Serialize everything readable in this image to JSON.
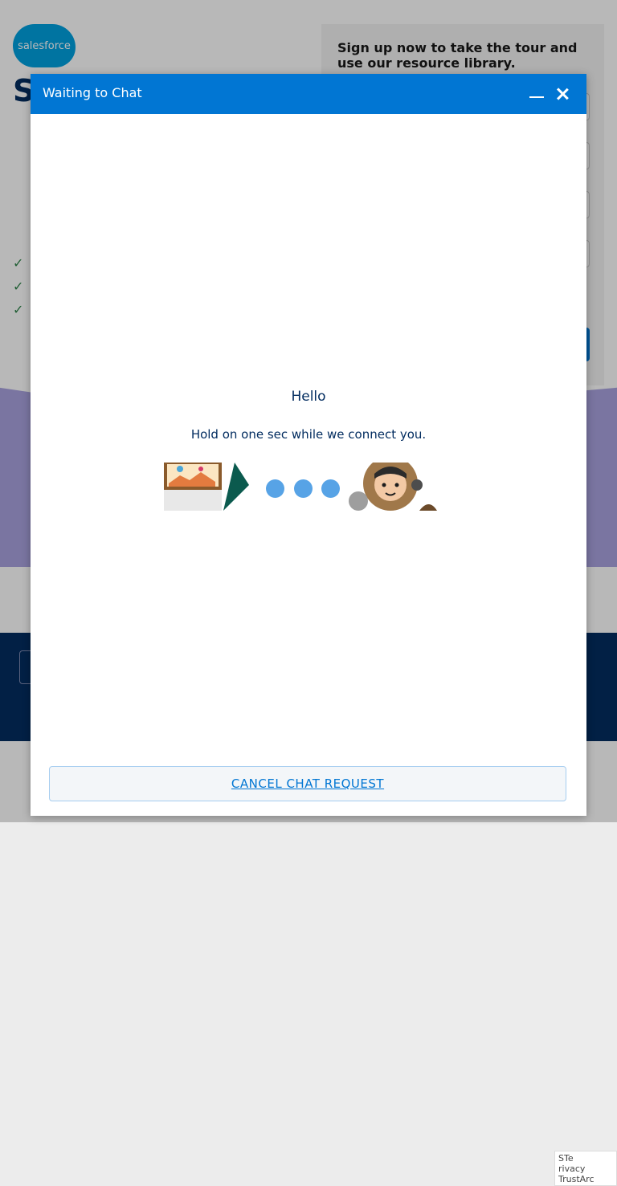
{
  "page": {
    "logo_text": "salesforce",
    "hero_title_visible": "Se",
    "signup_title": "Sign up now to take the tour and use our resource library.",
    "trust_badge": "STe\nrivacy\nTrustArc"
  },
  "chat": {
    "header_title": "Waiting to Chat",
    "greeting": "Hello",
    "subtext": "Hold on one sec while we connect you.",
    "cancel_label": "CANCEL CHAT REQUEST"
  },
  "colors": {
    "header_blue": "#0176d3",
    "text_navy": "#032d60",
    "dot_blue": "#57a3e6"
  },
  "icons": {
    "minimize": "minimize-icon",
    "close": "close-icon"
  }
}
